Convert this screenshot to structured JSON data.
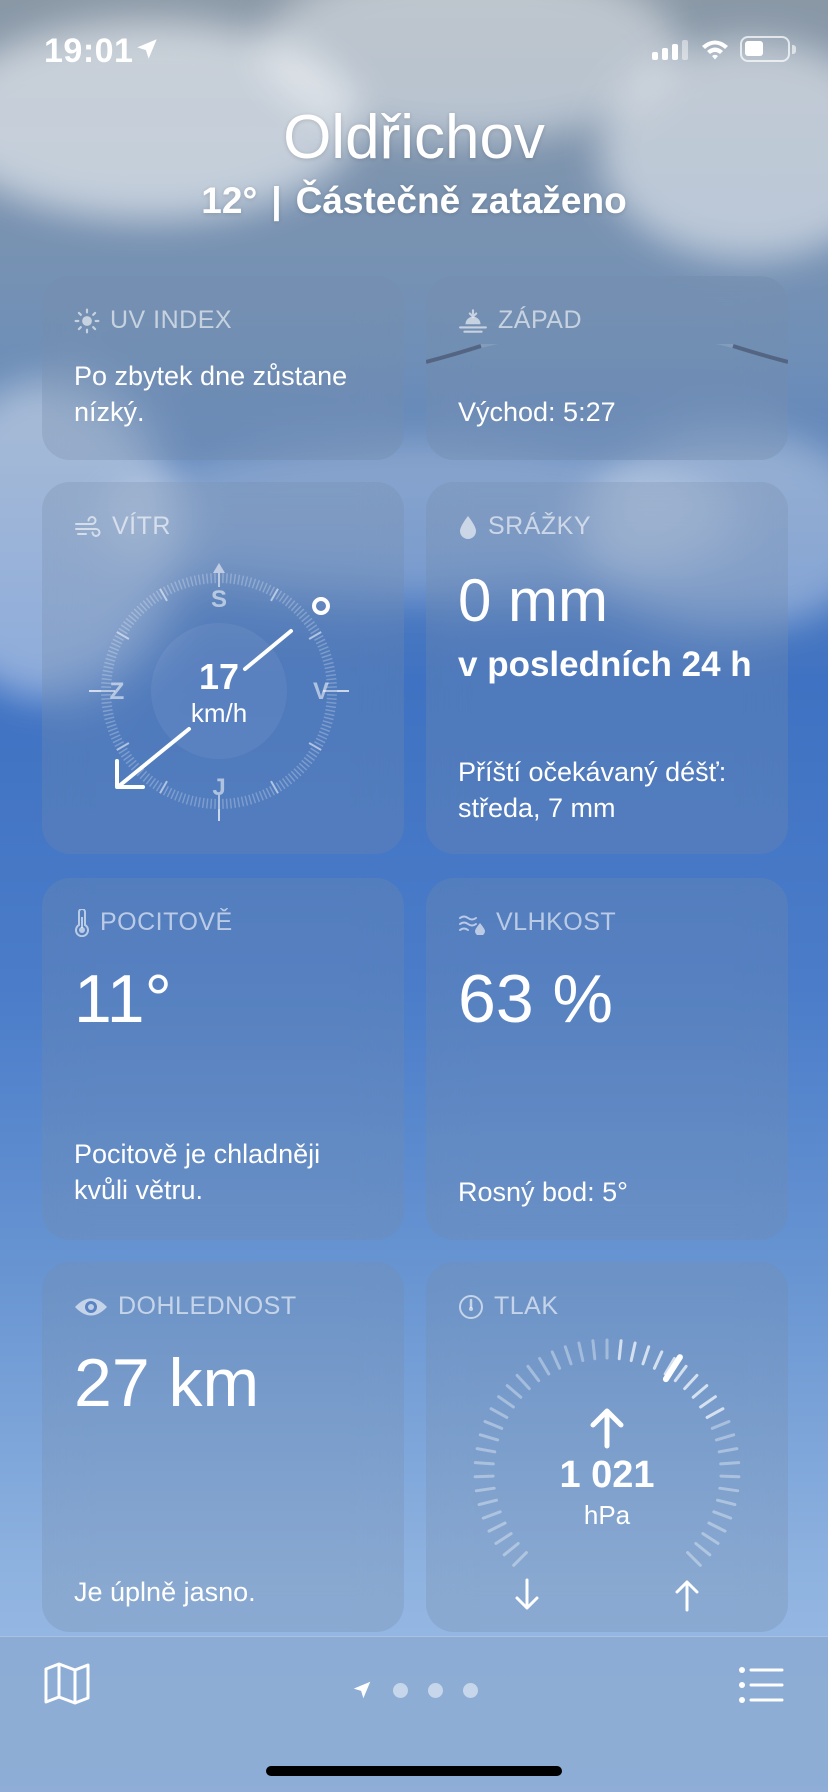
{
  "status": {
    "time": "19:01"
  },
  "header": {
    "city": "Oldřichov",
    "temp": "12°",
    "separator": "|",
    "condition": "Částečně zataženo"
  },
  "cards": {
    "uv": {
      "title": "UV INDEX",
      "text": "Po zbytek dne zůstane nízký."
    },
    "sunset": {
      "title": "ZÁPAD",
      "text": "Východ: 5:27"
    },
    "wind": {
      "title": "VÍTR",
      "speed": "17",
      "unit": "km/h",
      "north": "S",
      "east": "V",
      "south": "J",
      "west": "Z"
    },
    "precip": {
      "title": "SRÁŽKY",
      "value": "0 mm",
      "period": "v posledních 24 h",
      "next": "Příští očekávaný déšť: středa, 7 mm"
    },
    "feels": {
      "title": "POCITOVĚ",
      "value": "11°",
      "text": "Pocitově je chladněji kvůli větru."
    },
    "humidity": {
      "title": "VLHKOST",
      "value": "63 %",
      "text": "Rosný bod: 5°"
    },
    "visibility": {
      "title": "DOHLEDNOST",
      "value": "27 km",
      "text": "Je úplně jasno."
    },
    "pressure": {
      "title": "TLAK",
      "value": "1 021",
      "unit": "hPa",
      "level_fraction": 0.62,
      "trend": "rising"
    }
  },
  "tabbar": {
    "page_count": 3,
    "current_location": true
  }
}
